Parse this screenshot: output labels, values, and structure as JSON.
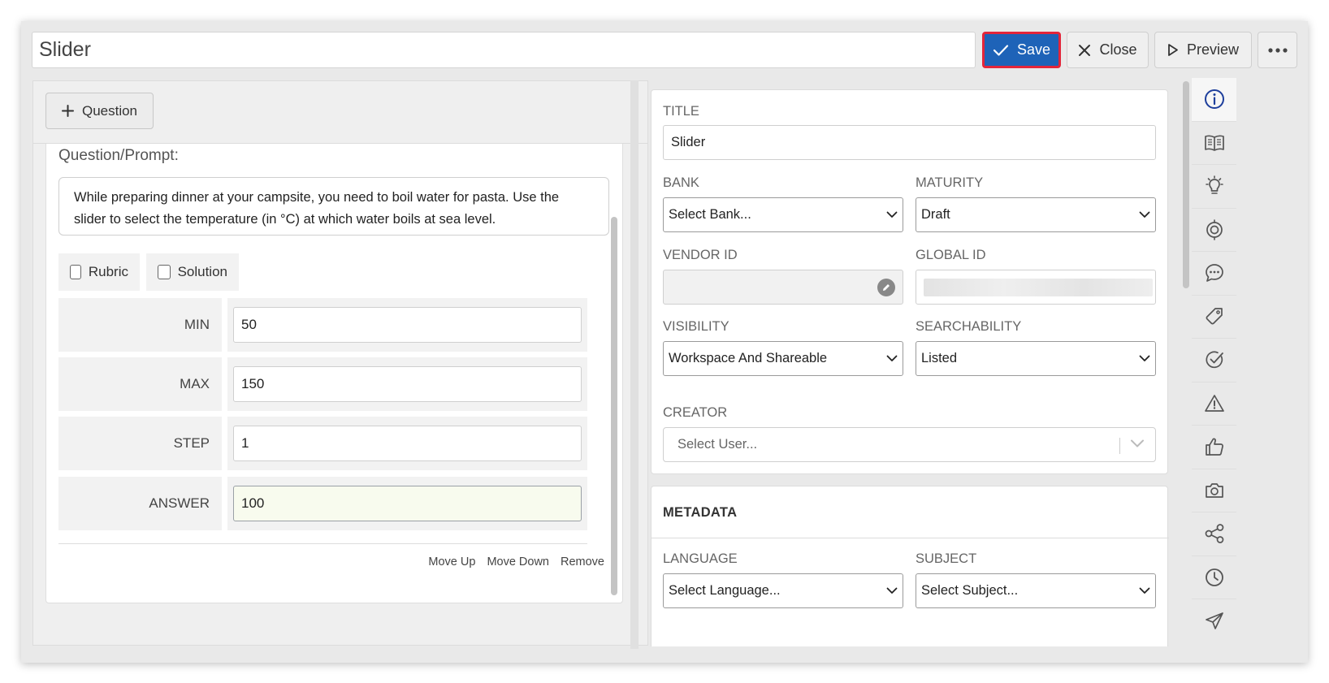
{
  "header": {
    "title_value": "Slider",
    "save_label": "Save",
    "close_label": "Close",
    "preview_label": "Preview"
  },
  "left": {
    "add_question_label": "Question",
    "prompt_label": "Question/Prompt:",
    "prompt_text": "While preparing dinner at your campsite, you need to boil water for pasta. Use the slider to select the temperature (in °C) at which water boils at sea level.",
    "rubric_label": "Rubric",
    "solution_label": "Solution",
    "fields": [
      {
        "label": "MIN",
        "value": "50"
      },
      {
        "label": "MAX",
        "value": "150"
      },
      {
        "label": "STEP",
        "value": "1"
      },
      {
        "label": "ANSWER",
        "value": "100"
      }
    ],
    "actions": {
      "move_up": "Move Up",
      "move_down": "Move Down",
      "remove": "Remove"
    }
  },
  "right": {
    "title_label": "TITLE",
    "title_value": "Slider",
    "bank_label": "BANK",
    "bank_value": "Select Bank...",
    "maturity_label": "MATURITY",
    "maturity_value": "Draft",
    "vendor_id_label": "VENDOR ID",
    "global_id_label": "GLOBAL ID",
    "visibility_label": "VISIBILITY",
    "visibility_value": "Workspace And Shareable",
    "searchability_label": "SEARCHABILITY",
    "searchability_value": "Listed",
    "creator_label": "CREATOR",
    "creator_placeholder": "Select User...",
    "metadata_title": "METADATA",
    "language_label": "LANGUAGE",
    "language_value": "Select Language...",
    "subject_label": "SUBJECT",
    "subject_value": "Select Subject..."
  },
  "rail_icons": [
    "info-icon",
    "book-icon",
    "lightbulb-icon",
    "target-icon",
    "comment-icon",
    "tag-icon",
    "check-circle-icon",
    "warning-icon",
    "thumbs-up-icon",
    "camera-icon",
    "share-icon",
    "clock-icon",
    "send-icon"
  ],
  "colors": {
    "primary": "#1e63b8",
    "highlight_border": "#e3253a",
    "info_icon": "#1e3f9c"
  }
}
